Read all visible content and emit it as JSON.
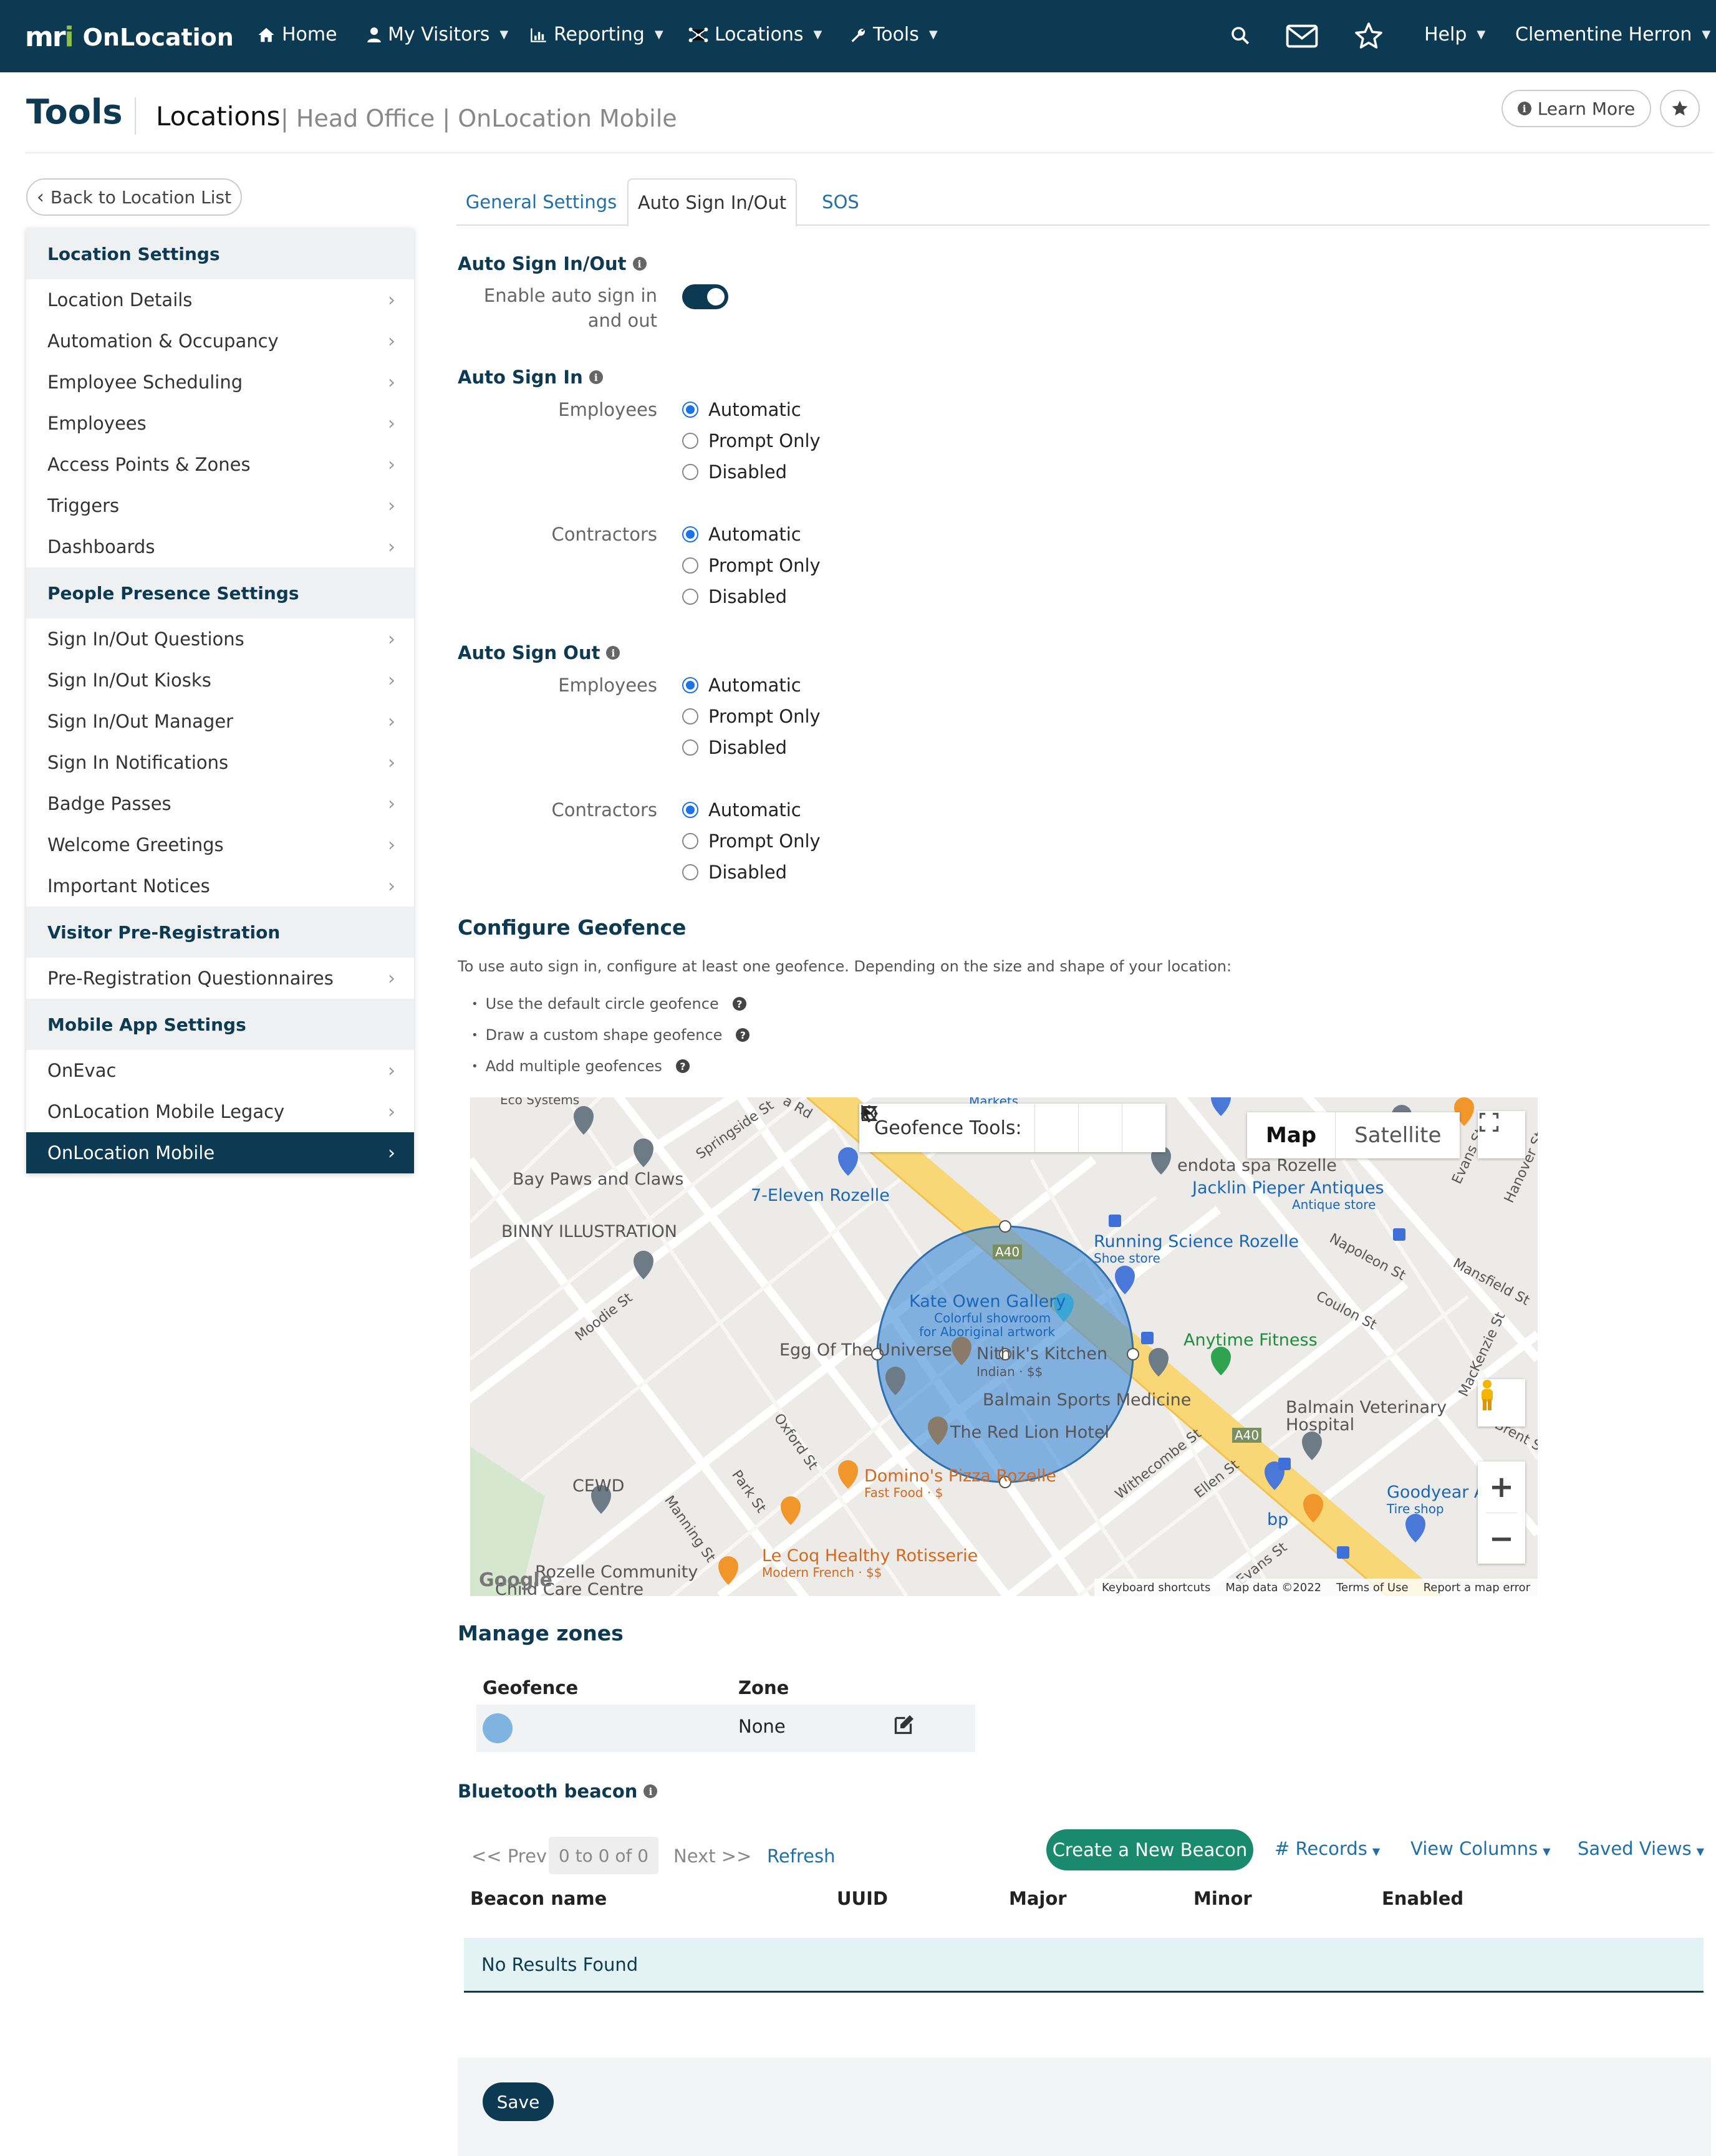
{
  "nav": {
    "brand": "OnLocation",
    "items": [
      {
        "label": "Home",
        "icon": "home-icon"
      },
      {
        "label": "My Visitors",
        "icon": "user-icon"
      },
      {
        "label": "Reporting",
        "icon": "chart-icon"
      },
      {
        "label": "Locations",
        "icon": "network-icon"
      },
      {
        "label": "Tools",
        "icon": "wrench-icon"
      }
    ],
    "help": "Help",
    "user": "Clementine Herron"
  },
  "header": {
    "title": "Tools",
    "breadcrumb_main": "Locations",
    "breadcrumb_sub": "| Head Office | OnLocation Mobile",
    "learn_more": "Learn More"
  },
  "sidebar": {
    "back": "Back to Location List",
    "sections": [
      {
        "title": "Location Settings",
        "items": [
          "Location Details",
          "Automation & Occupancy",
          "Employee Scheduling",
          "Employees",
          "Access Points & Zones",
          "Triggers",
          "Dashboards"
        ]
      },
      {
        "title": "People Presence Settings",
        "items": [
          "Sign In/Out Questions",
          "Sign In/Out Kiosks",
          "Sign In/Out Manager",
          "Sign In Notifications",
          "Badge Passes",
          "Welcome Greetings",
          "Important Notices"
        ]
      },
      {
        "title": "Visitor Pre-Registration",
        "items": [
          "Pre-Registration Questionnaires"
        ]
      },
      {
        "title": "Mobile App Settings",
        "items": [
          "OnEvac",
          "OnLocation Mobile Legacy",
          "OnLocation Mobile"
        ]
      }
    ],
    "active": "OnLocation Mobile"
  },
  "tabs": [
    {
      "label": "General Settings"
    },
    {
      "label": "Auto Sign In/Out"
    },
    {
      "label": "SOS"
    }
  ],
  "form": {
    "auto_inout_title": "Auto Sign In/Out",
    "enable_label": "Enable auto sign in and out",
    "auto_in_title": "Auto Sign In",
    "auto_out_title": "Auto Sign Out",
    "employees_label": "Employees",
    "contractors_label": "Contractors",
    "options": [
      "Automatic",
      "Prompt Only",
      "Disabled"
    ],
    "selected": "Automatic"
  },
  "geofence": {
    "title": "Configure Geofence",
    "description": "To use auto sign in, configure at least one geofence. Depending on the size and shape of your location:",
    "bullets": [
      "Use the default circle geofence",
      "Draw a custom shape geofence",
      "Add multiple geofences"
    ]
  },
  "map": {
    "tools_label": "Geofence Tools:",
    "map_types": [
      "Map",
      "Satellite"
    ],
    "selected_type": "Map",
    "labels": {
      "bay_paws": "Bay Paws and Claws",
      "binny": "BINNY ILLUSTRATION",
      "seven_eleven": "7-Eleven Rozelle",
      "kate_owen": "Kate Owen Gallery",
      "kate_owen_sub1": "Colorful showroom",
      "kate_owen_sub2": "for Aboriginal artwork",
      "egg": "Egg Of The Universe",
      "nithik": "Nithik's Kitchen",
      "nithik_sub": "Indian · $$",
      "balmain_sports": "Balmain Sports Medicine",
      "red_lion": "The Red Lion Hotel",
      "dominos": "Domino's Pizza Rozelle",
      "dominos_sub": "Fast Food · $",
      "le_coq": "Le Coq Healthy Rotisserie",
      "le_coq_sub": "Modern French · $$",
      "cewd": "CEWD",
      "community": "Rozelle Community",
      "community2": "Child Care Centre",
      "running": "Running Science Rozelle",
      "running_sub": "Shoe store",
      "jacklin": "Jacklin Pieper Antiques",
      "jacklin_sub": "Antique store",
      "endota": "endota spa Rozelle",
      "anytime": "Anytime Fitness",
      "vet": "Balmain Veterinary",
      "vet2": "Hospital",
      "goodyear": "Goodyear A",
      "goodyear_sub": "Tire shop",
      "bp": "bp",
      "markets": "Markets",
      "eco": "Eco Systems",
      "a40": "A40",
      "streets": {
        "springside": "Springside St",
        "moodie": "Moodie St",
        "oxford": "Oxford St",
        "park": "Park St",
        "manning": "Manning St",
        "withecombe": "Withecombe St",
        "ellen": "Ellen St",
        "evans": "Evans St",
        "napoleon": "Napoleon St",
        "coulon": "Coulon St",
        "mansfield": "Mansfield St",
        "mackenzie": "MacKenzie St",
        "hanover": "Hanover St",
        "evans2": "Evans St",
        "brent": "Brent S",
        "darling": "a Rd"
      }
    },
    "footer": [
      "Keyboard shortcuts",
      "Map data ©2022",
      "Terms of Use",
      "Report a map error"
    ],
    "google": "Google"
  },
  "zones": {
    "title": "Manage zones",
    "col_geofence": "Geofence",
    "col_zone": "Zone",
    "row_zone": "None",
    "swatch_color": "#7fb3e0"
  },
  "beacon": {
    "title": "Bluetooth beacon",
    "prev": "<< Prev",
    "range": "0 to 0 of 0",
    "next": "Next >>",
    "refresh": "Refresh",
    "create": "Create a New Beacon",
    "records": "# Records",
    "view_columns": "View Columns",
    "saved_views": "Saved Views",
    "columns": [
      "Beacon name",
      "UUID",
      "Major",
      "Minor",
      "Enabled"
    ],
    "empty": "No Results Found"
  },
  "save": "Save",
  "colors": {
    "primary": "#0c3a52",
    "link": "#1f6fa8",
    "create": "#1a8a6e",
    "geofence": "#4a90d9"
  }
}
